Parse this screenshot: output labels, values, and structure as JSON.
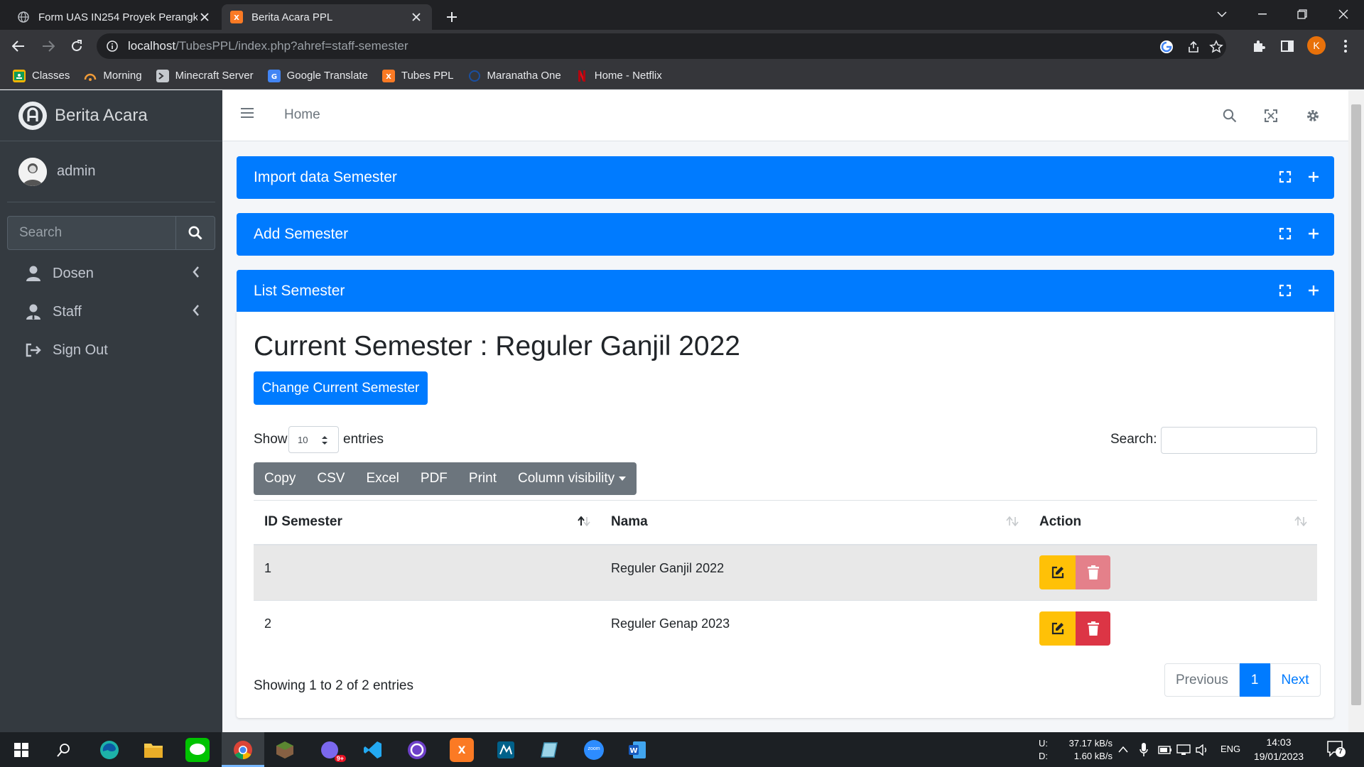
{
  "browser": {
    "tabs": [
      {
        "title": "Form UAS IN254 Proyek Perangk",
        "active": false
      },
      {
        "title": "Berita Acara PPL",
        "active": true
      }
    ],
    "url_host": "localhost",
    "url_path": "/TubesPPL/index.php?ahref=staff-semester",
    "profile_initial": "K",
    "bookmarks": [
      "Classes",
      "Morning",
      "Minecraft Server",
      "Google Translate",
      "Tubes PPL",
      "Maranatha One",
      "Home - Netflix"
    ]
  },
  "sidebar": {
    "brand": "Berita Acara",
    "user": "admin",
    "search_placeholder": "Search",
    "items": [
      {
        "label": "Dosen",
        "icon": "user-icon",
        "has_submenu": true
      },
      {
        "label": "Staff",
        "icon": "user-tie-icon",
        "has_submenu": true
      },
      {
        "label": "Sign Out",
        "icon": "sign-out-icon",
        "has_submenu": false
      }
    ]
  },
  "topnav": {
    "home": "Home"
  },
  "cards": {
    "import": "Import data Semester",
    "add": "Add Semester",
    "list": "List Semester"
  },
  "main": {
    "current_semester": "Current Semester : Reguler Ganjil 2022",
    "change_button": "Change Current Semester",
    "show": "Show",
    "entries": "entries",
    "page_length": "10",
    "search_label": "Search:",
    "export_buttons": [
      "Copy",
      "CSV",
      "Excel",
      "PDF",
      "Print",
      "Column visibility"
    ],
    "table": {
      "headers": [
        "ID Semester",
        "Nama",
        "Action"
      ],
      "rows": [
        {
          "id": "1",
          "nama": "Reguler Ganjil 2022"
        },
        {
          "id": "2",
          "nama": "Reguler Genap 2023"
        }
      ]
    },
    "info": "Showing 1 to 2 of 2 entries",
    "pagination": {
      "previous": "Previous",
      "current": "1",
      "next": "Next"
    }
  },
  "taskbar": {
    "net_up_label": "U:",
    "net_down_label": "D:",
    "net_up": "37.17 kB/s",
    "net_down": "1.60 kB/s",
    "lang": "ENG",
    "time": "14:03",
    "date": "19/01/2023",
    "notif_count": "7",
    "mail_badge": "9+",
    "zoom_label": "zoom"
  },
  "colors": {
    "primary": "#007bff",
    "sidebar": "#343a40",
    "warning": "#ffc107",
    "danger": "#dc3545"
  }
}
